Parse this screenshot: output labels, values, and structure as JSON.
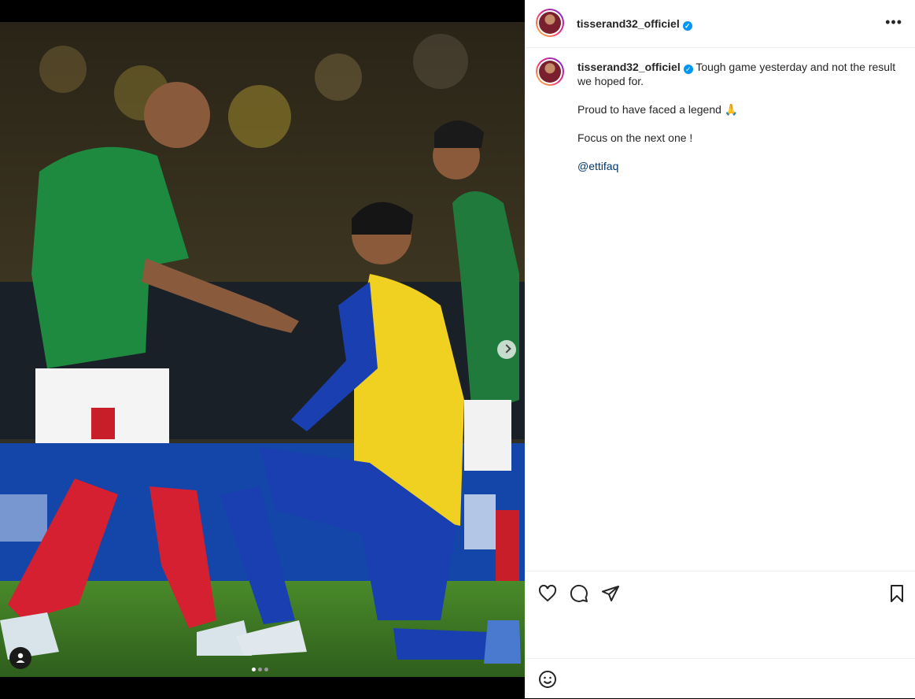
{
  "post": {
    "username": "tisserand32_officiel",
    "verified_mark": "✓",
    "more_label": "•••"
  },
  "caption": {
    "username": "tisserand32_officiel",
    "line1": "Tough game yesterday and not the result we hoped for.",
    "line2": "Proud to have faced a legend 🙏",
    "line3": "Focus on the next one !",
    "mention": "@ettifaq"
  },
  "icons": {
    "like": "heart-icon",
    "comment": "comment-icon",
    "share": "send-icon",
    "save": "bookmark-icon",
    "emoji": "emoji-icon",
    "next": "chevron-right-icon",
    "tags": "user-tag-icon"
  },
  "carousel": {
    "count": 3,
    "active": 1
  },
  "colors": {
    "accent": "#0095f6",
    "mention": "#00376b"
  }
}
